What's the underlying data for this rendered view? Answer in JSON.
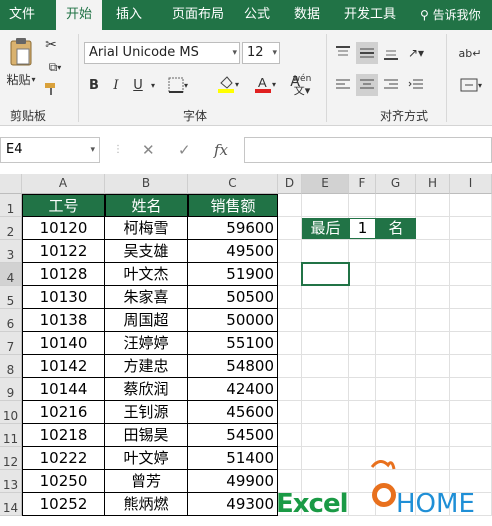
{
  "tabs": [
    "文件",
    "开始",
    "插入",
    "页面布局",
    "公式",
    "数据",
    "开发工具"
  ],
  "tell_me": "告诉我你",
  "clipboard": {
    "paste": "粘贴",
    "group": "剪贴板"
  },
  "font": {
    "name": "Arial Unicode MS",
    "size": "12",
    "group": "字体",
    "bold": "B",
    "italic": "I",
    "underline": "U",
    "wen": "wén"
  },
  "align": {
    "group": "对齐方式"
  },
  "formula": {
    "namebox": "E4",
    "fx": "fx",
    "cancel": "✕",
    "confirm": "✓",
    "value": ""
  },
  "columns": [
    "A",
    "B",
    "C",
    "D",
    "E",
    "F",
    "G",
    "H",
    "I"
  ],
  "rows": [
    "1",
    "2",
    "3",
    "4",
    "5",
    "6",
    "7",
    "8",
    "9",
    "10",
    "11",
    "12",
    "13",
    "14"
  ],
  "table": {
    "headers": [
      "工号",
      "姓名",
      "销售额"
    ],
    "records": [
      [
        "10120",
        "柯梅雪",
        "59600"
      ],
      [
        "10122",
        "吴支雄",
        "49500"
      ],
      [
        "10128",
        "叶文杰",
        "51900"
      ],
      [
        "10130",
        "朱家喜",
        "50500"
      ],
      [
        "10138",
        "周国超",
        "50000"
      ],
      [
        "10140",
        "汪婷婷",
        "55100"
      ],
      [
        "10142",
        "方建忠",
        "54800"
      ],
      [
        "10144",
        "蔡欣润",
        "42400"
      ],
      [
        "10216",
        "王钊源",
        "45600"
      ],
      [
        "10218",
        "田锡昊",
        "54500"
      ],
      [
        "10222",
        "叶文婷",
        "51400"
      ],
      [
        "10250",
        "曾芳",
        "49900"
      ],
      [
        "10252",
        "熊炳燃",
        "49300"
      ]
    ]
  },
  "criteria": {
    "label": "最后",
    "n": "1",
    "suffix": "名"
  },
  "logo": {
    "excel": "Excel",
    "home": "HOME"
  },
  "colors": {
    "accent": "#217346",
    "logo_orange": "#e8701d",
    "logo_blue": "#1f8fd6"
  }
}
